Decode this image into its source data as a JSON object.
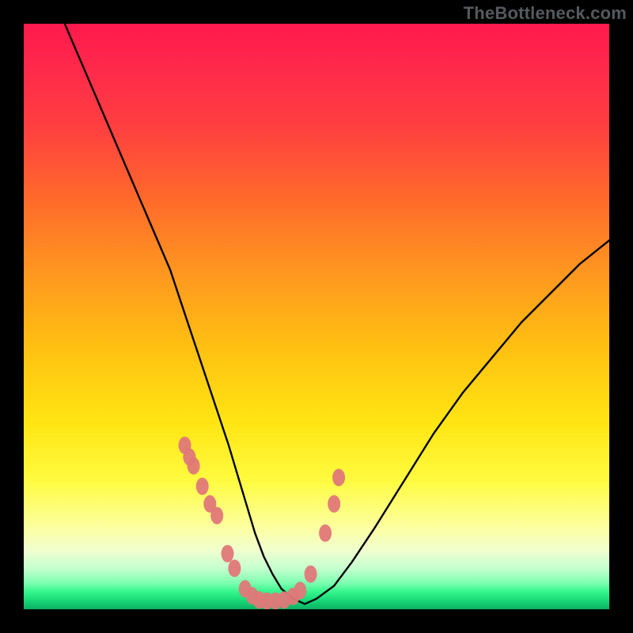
{
  "watermark": "TheBottleneck.com",
  "chart_data": {
    "type": "line",
    "title": "",
    "xlabel": "",
    "ylabel": "",
    "xlim": [
      0,
      100
    ],
    "ylim": [
      0,
      100
    ],
    "grid": false,
    "legend": false,
    "background": "rainbow-gradient",
    "series": [
      {
        "name": "curve",
        "style": "line",
        "color": "#000000",
        "x": [
          7,
          10,
          13,
          16,
          19,
          22,
          25,
          27,
          29,
          31,
          33,
          35,
          36.5,
          38,
          39.5,
          41,
          42.5,
          44,
          46,
          48,
          50,
          53,
          56,
          60,
          65,
          70,
          75,
          80,
          85,
          90,
          95,
          100
        ],
        "y": [
          100,
          93,
          86,
          79,
          72,
          65,
          58,
          52,
          46,
          40,
          34,
          28,
          23,
          18,
          13,
          9,
          6,
          3.5,
          1.8,
          0.9,
          1.8,
          4,
          8,
          14,
          22,
          30,
          37,
          43,
          49,
          54,
          59,
          63
        ]
      },
      {
        "name": "markers",
        "style": "scatter",
        "color": "#e07878",
        "x": [
          27.5,
          28.3,
          29.0,
          30.5,
          31.8,
          33.0,
          34.8,
          36.0,
          37.8,
          39.0,
          40.2,
          41.5,
          43.0,
          44.5,
          46.0,
          47.2,
          49.0,
          51.5,
          53.0,
          53.8
        ],
        "y": [
          28.0,
          26.0,
          24.5,
          21.0,
          18.0,
          16.0,
          9.5,
          7.0,
          3.5,
          2.3,
          1.6,
          1.4,
          1.4,
          1.6,
          2.2,
          3.2,
          6.0,
          13.0,
          18.0,
          22.5
        ]
      }
    ]
  }
}
